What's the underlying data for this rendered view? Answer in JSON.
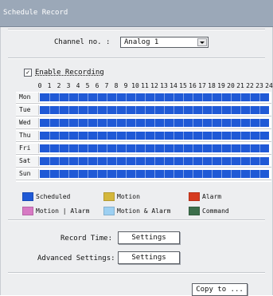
{
  "window": {
    "title": "Schedule Record"
  },
  "channel": {
    "label": "Channel no. :",
    "value": "Analog 1"
  },
  "enable_recording": {
    "label": "Enable Recording",
    "checked": true
  },
  "hours": [
    "0",
    "1",
    "2",
    "3",
    "4",
    "5",
    "6",
    "7",
    "8",
    "9",
    "10",
    "11",
    "12",
    "13",
    "14",
    "15",
    "16",
    "17",
    "18",
    "19",
    "20",
    "21",
    "22",
    "23",
    "24"
  ],
  "days": [
    "Mon",
    "Tue",
    "Wed",
    "Thu",
    "Fri",
    "Sat",
    "Sun"
  ],
  "schedule_fill": [
    1,
    1,
    1,
    1,
    1,
    1,
    1
  ],
  "legend": [
    {
      "label": "Scheduled",
      "color": "#1f59d6"
    },
    {
      "label": "Motion",
      "color": "#d4b73c"
    },
    {
      "label": "Alarm",
      "color": "#d63b1f"
    },
    {
      "label": "Motion | Alarm",
      "color": "#d77ac4"
    },
    {
      "label": "Motion & Alarm",
      "color": "#9dd0f2"
    },
    {
      "label": "Command",
      "color": "#3c6e4b"
    }
  ],
  "record_time": {
    "label": "Record Time:",
    "button": "Settings"
  },
  "advanced_settings": {
    "label": "Advanced Settings:",
    "button": "Settings"
  },
  "copy_button": "Copy to ..."
}
